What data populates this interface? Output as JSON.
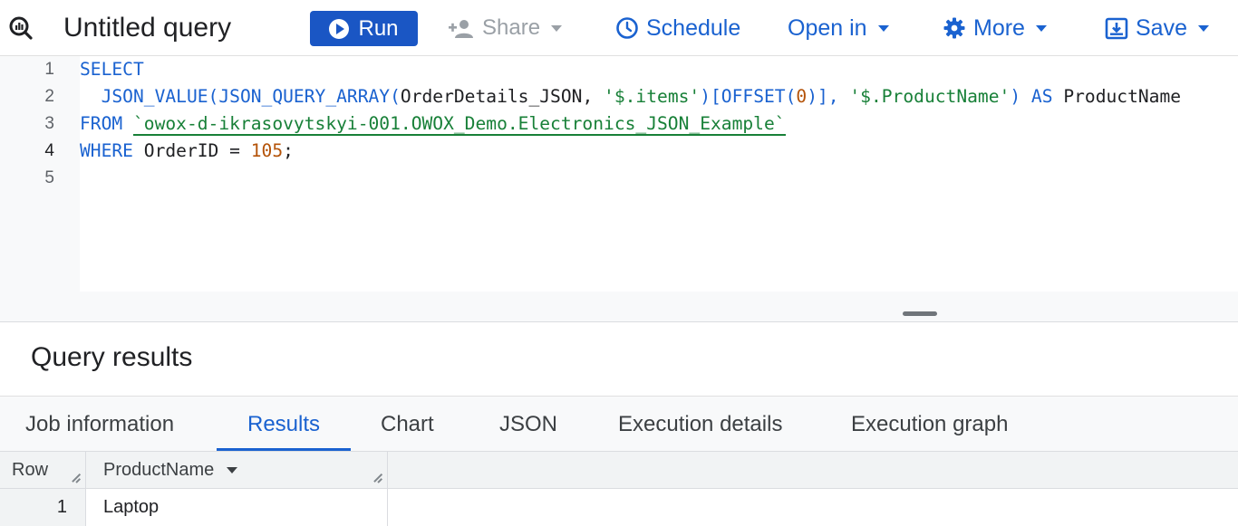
{
  "toolbar": {
    "title": "Untitled query",
    "run_label": "Run",
    "share_label": "Share",
    "schedule_label": "Schedule",
    "open_in_label": "Open in",
    "more_label": "More",
    "save_label": "Save"
  },
  "editor": {
    "line_numbers": [
      "1",
      "2",
      "3",
      "4",
      "5"
    ],
    "active_line": 4,
    "lines": [
      [
        {
          "t": "SELECT",
          "c": "kw"
        }
      ],
      [
        {
          "t": "  JSON_VALUE(JSON_QUERY_ARRAY(",
          "c": "kw"
        },
        {
          "t": "OrderDetails_JSON, ",
          "c": "plain"
        },
        {
          "t": "'$.items'",
          "c": "str"
        },
        {
          "t": ")[OFFSET(",
          "c": "kw"
        },
        {
          "t": "0",
          "c": "num"
        },
        {
          "t": ")], ",
          "c": "kw"
        },
        {
          "t": "'$.ProductName'",
          "c": "str"
        },
        {
          "t": ") AS ",
          "c": "kw"
        },
        {
          "t": "ProductName",
          "c": "plain"
        }
      ],
      [
        {
          "t": "FROM ",
          "c": "kw"
        },
        {
          "t": "`owox-d-ikrasovytskyi-001.OWOX_Demo.Electronics_JSON_Example`",
          "c": "tbl"
        }
      ],
      [
        {
          "t": "WHERE ",
          "c": "kw"
        },
        {
          "t": "OrderID = ",
          "c": "plain"
        },
        {
          "t": "105",
          "c": "num"
        },
        {
          "t": ";",
          "c": "plain"
        }
      ],
      []
    ]
  },
  "results": {
    "title": "Query results",
    "tabs": [
      "Job information",
      "Results",
      "Chart",
      "JSON",
      "Execution details",
      "Execution graph"
    ],
    "active_tab": "Results",
    "columns": [
      "Row",
      "ProductName"
    ],
    "rows": [
      [
        "1",
        "Laptop"
      ]
    ]
  },
  "colors": {
    "accent": "#1a62d0",
    "run_button": "#1a56c4",
    "string": "#188038",
    "number": "#b45309"
  },
  "icons": [
    "query-icon",
    "play-icon",
    "person-add-icon",
    "clock-icon",
    "gear-icon",
    "save-icon",
    "caret-down-icon"
  ]
}
